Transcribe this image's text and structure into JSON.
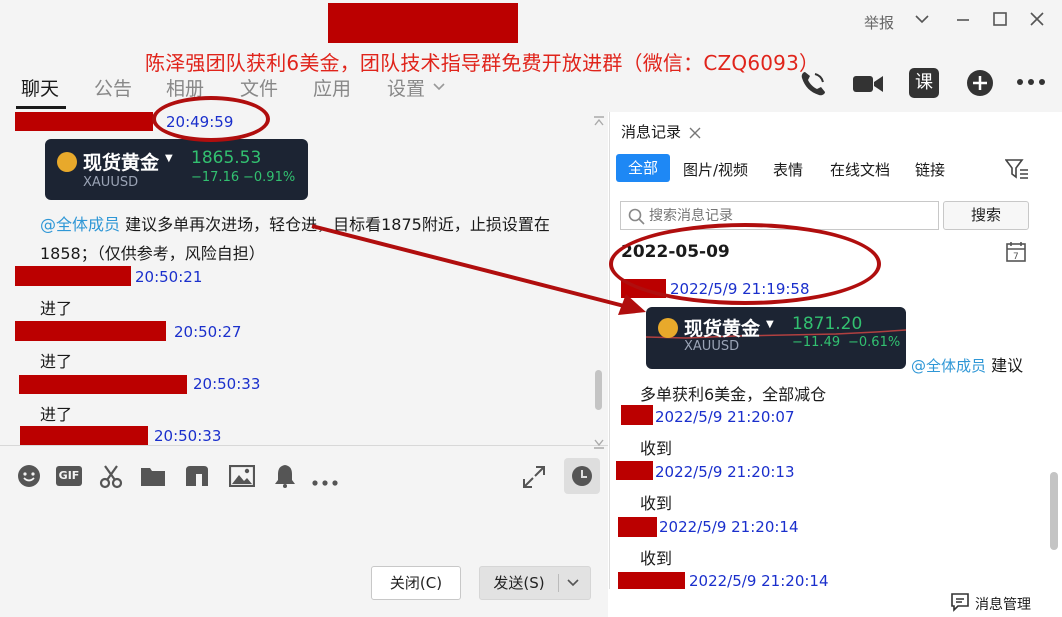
{
  "promo_banner": "陈泽强团队获利6美金，团队技术指导群免费开放进群（微信：CZQ6093）",
  "window_controls": {
    "report": "举报"
  },
  "main_tabs": [
    "聊天",
    "公告",
    "相册",
    "文件",
    "应用",
    "设置"
  ],
  "chat": {
    "messages": [
      {
        "time": "20:49:59"
      },
      {
        "card": {
          "name": "现货黄金",
          "code": "XAUUSD",
          "price": "1865.53",
          "change": "−17.16",
          "change_pct": "−0.91%"
        }
      },
      {
        "mention": "@全体成员",
        "text_line1": " 建议多单再次进场，轻仓进，目标看1875附近，止损设置在",
        "text_line2": "1858；（仅供参考，风险自担）"
      },
      {
        "time": "20:50:21",
        "text": "进了"
      },
      {
        "time": "20:50:27",
        "text": "进了"
      },
      {
        "time": "20:50:33",
        "text": "进了"
      },
      {
        "time": "20:50:33"
      }
    ],
    "close_button": "关闭(C)",
    "send_button": "发送(S)"
  },
  "history": {
    "title": "消息记录",
    "tabs": [
      "全部",
      "图片/视频",
      "表情",
      "在线文档",
      "链接"
    ],
    "search_placeholder": "搜索消息记录",
    "search_button": "搜索",
    "date": "2022-05-09",
    "card": {
      "name": "现货黄金",
      "code": "XAUUSD",
      "price": "1871.20",
      "change": "−11.49",
      "change_pct": "−0.61%"
    },
    "entries": [
      {
        "time": "2022/5/9 21:19:58"
      },
      {
        "mention": "@全体成员",
        "text": " 建议",
        "text2": "多单获利6美金，全部减仓"
      },
      {
        "time": "2022/5/9 21:20:07",
        "text": "收到"
      },
      {
        "time": "2022/5/9 21:20:13",
        "text": "收到"
      },
      {
        "time": "2022/5/9 21:20:14",
        "text": "收到"
      },
      {
        "time": "2022/5/9 21:20:14"
      }
    ],
    "manage": "消息管理"
  },
  "colors": {
    "accent": "#1e88f5",
    "annotation": "#b00e0e",
    "gain": "#32c070",
    "time": "#1a2fcc"
  }
}
